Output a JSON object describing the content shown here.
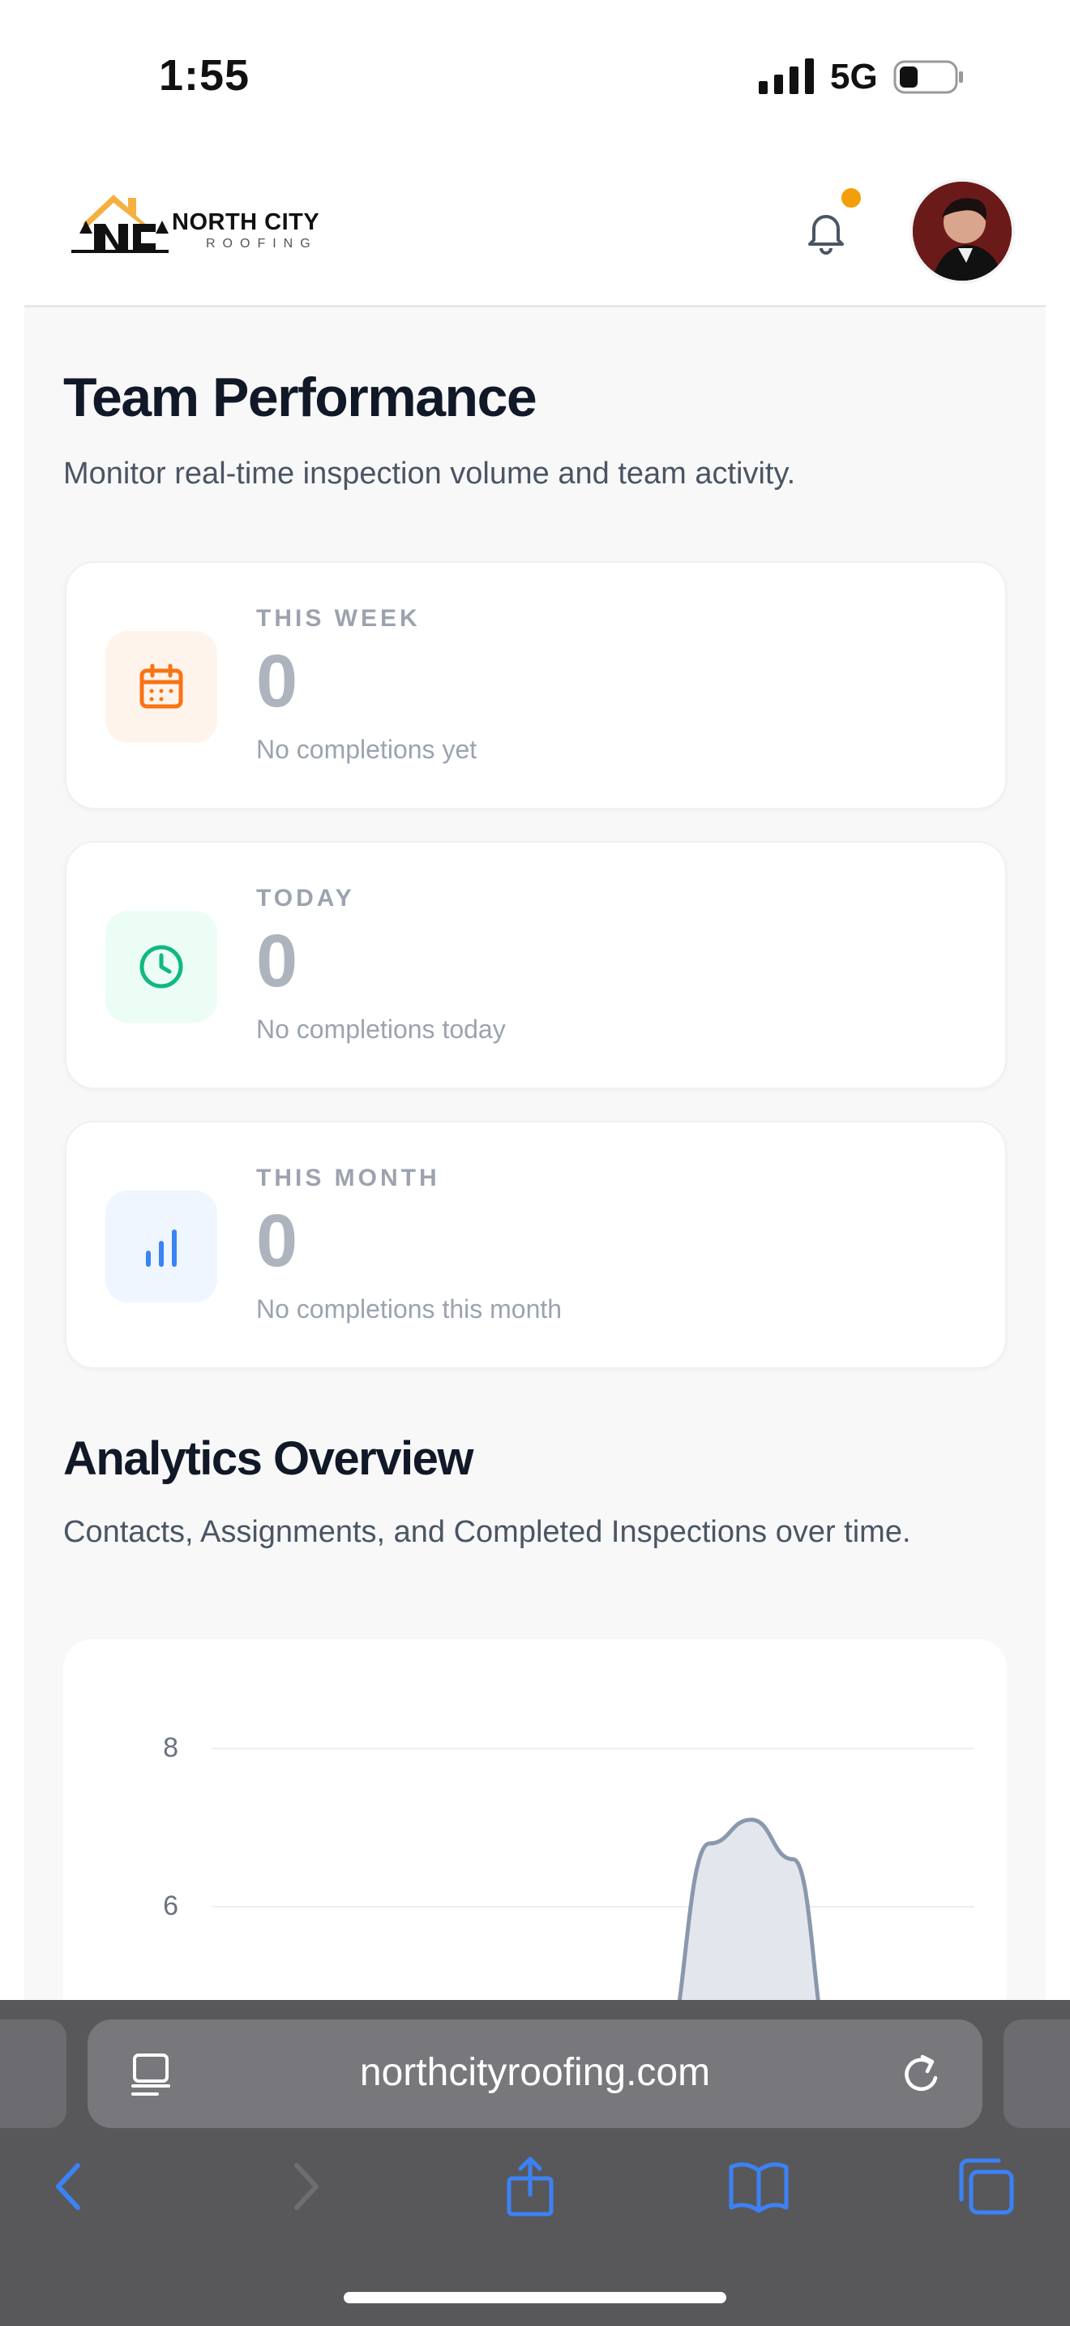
{
  "status_bar": {
    "time": "1:55",
    "network": "5G"
  },
  "header": {
    "brand_title": "NORTH CITY",
    "brand_subtitle": "ROOFING",
    "icons": [
      "bell-icon",
      "avatar"
    ],
    "notification_dot_color": "#f59e0b"
  },
  "page": {
    "title": "Team Performance",
    "subtitle": "Monitor real-time inspection volume and team activity."
  },
  "stats": [
    {
      "label": "THIS WEEK",
      "value": "0",
      "note": "No completions yet",
      "icon": "calendar-icon",
      "accent": "#f97316",
      "bg": "#fff4eb"
    },
    {
      "label": "TODAY",
      "value": "0",
      "note": "No completions today",
      "icon": "clock-icon",
      "accent": "#10b981",
      "bg": "#ecfdf5"
    },
    {
      "label": "THIS MONTH",
      "value": "0",
      "note": "No completions this month",
      "icon": "bar-chart-icon",
      "accent": "#3b82f6",
      "bg": "#eff6ff"
    }
  ],
  "analytics": {
    "title": "Analytics Overview",
    "subtitle": "Contacts, Assignments, and Completed Inspections over time."
  },
  "chart_data": {
    "type": "area",
    "y_ticks": [
      "8",
      "6"
    ],
    "ylim": [
      4,
      8.8
    ],
    "series": [
      {
        "color": "#8a98ae",
        "fill": "#e3e6ec",
        "x": [
          0.0,
          0.42,
          0.55,
          0.62,
          0.68,
          0.74,
          0.8,
          1.0
        ],
        "y": [
          0,
          0,
          4,
          6.8,
          7.1,
          6.6,
          4,
          0
        ]
      }
    ],
    "grid": true
  },
  "browser": {
    "url": "northcityroofing.com",
    "icons": [
      "reader-icon",
      "reload-icon",
      "back-icon",
      "forward-icon",
      "share-icon",
      "bookmarks-icon",
      "tabs-icon"
    ]
  }
}
